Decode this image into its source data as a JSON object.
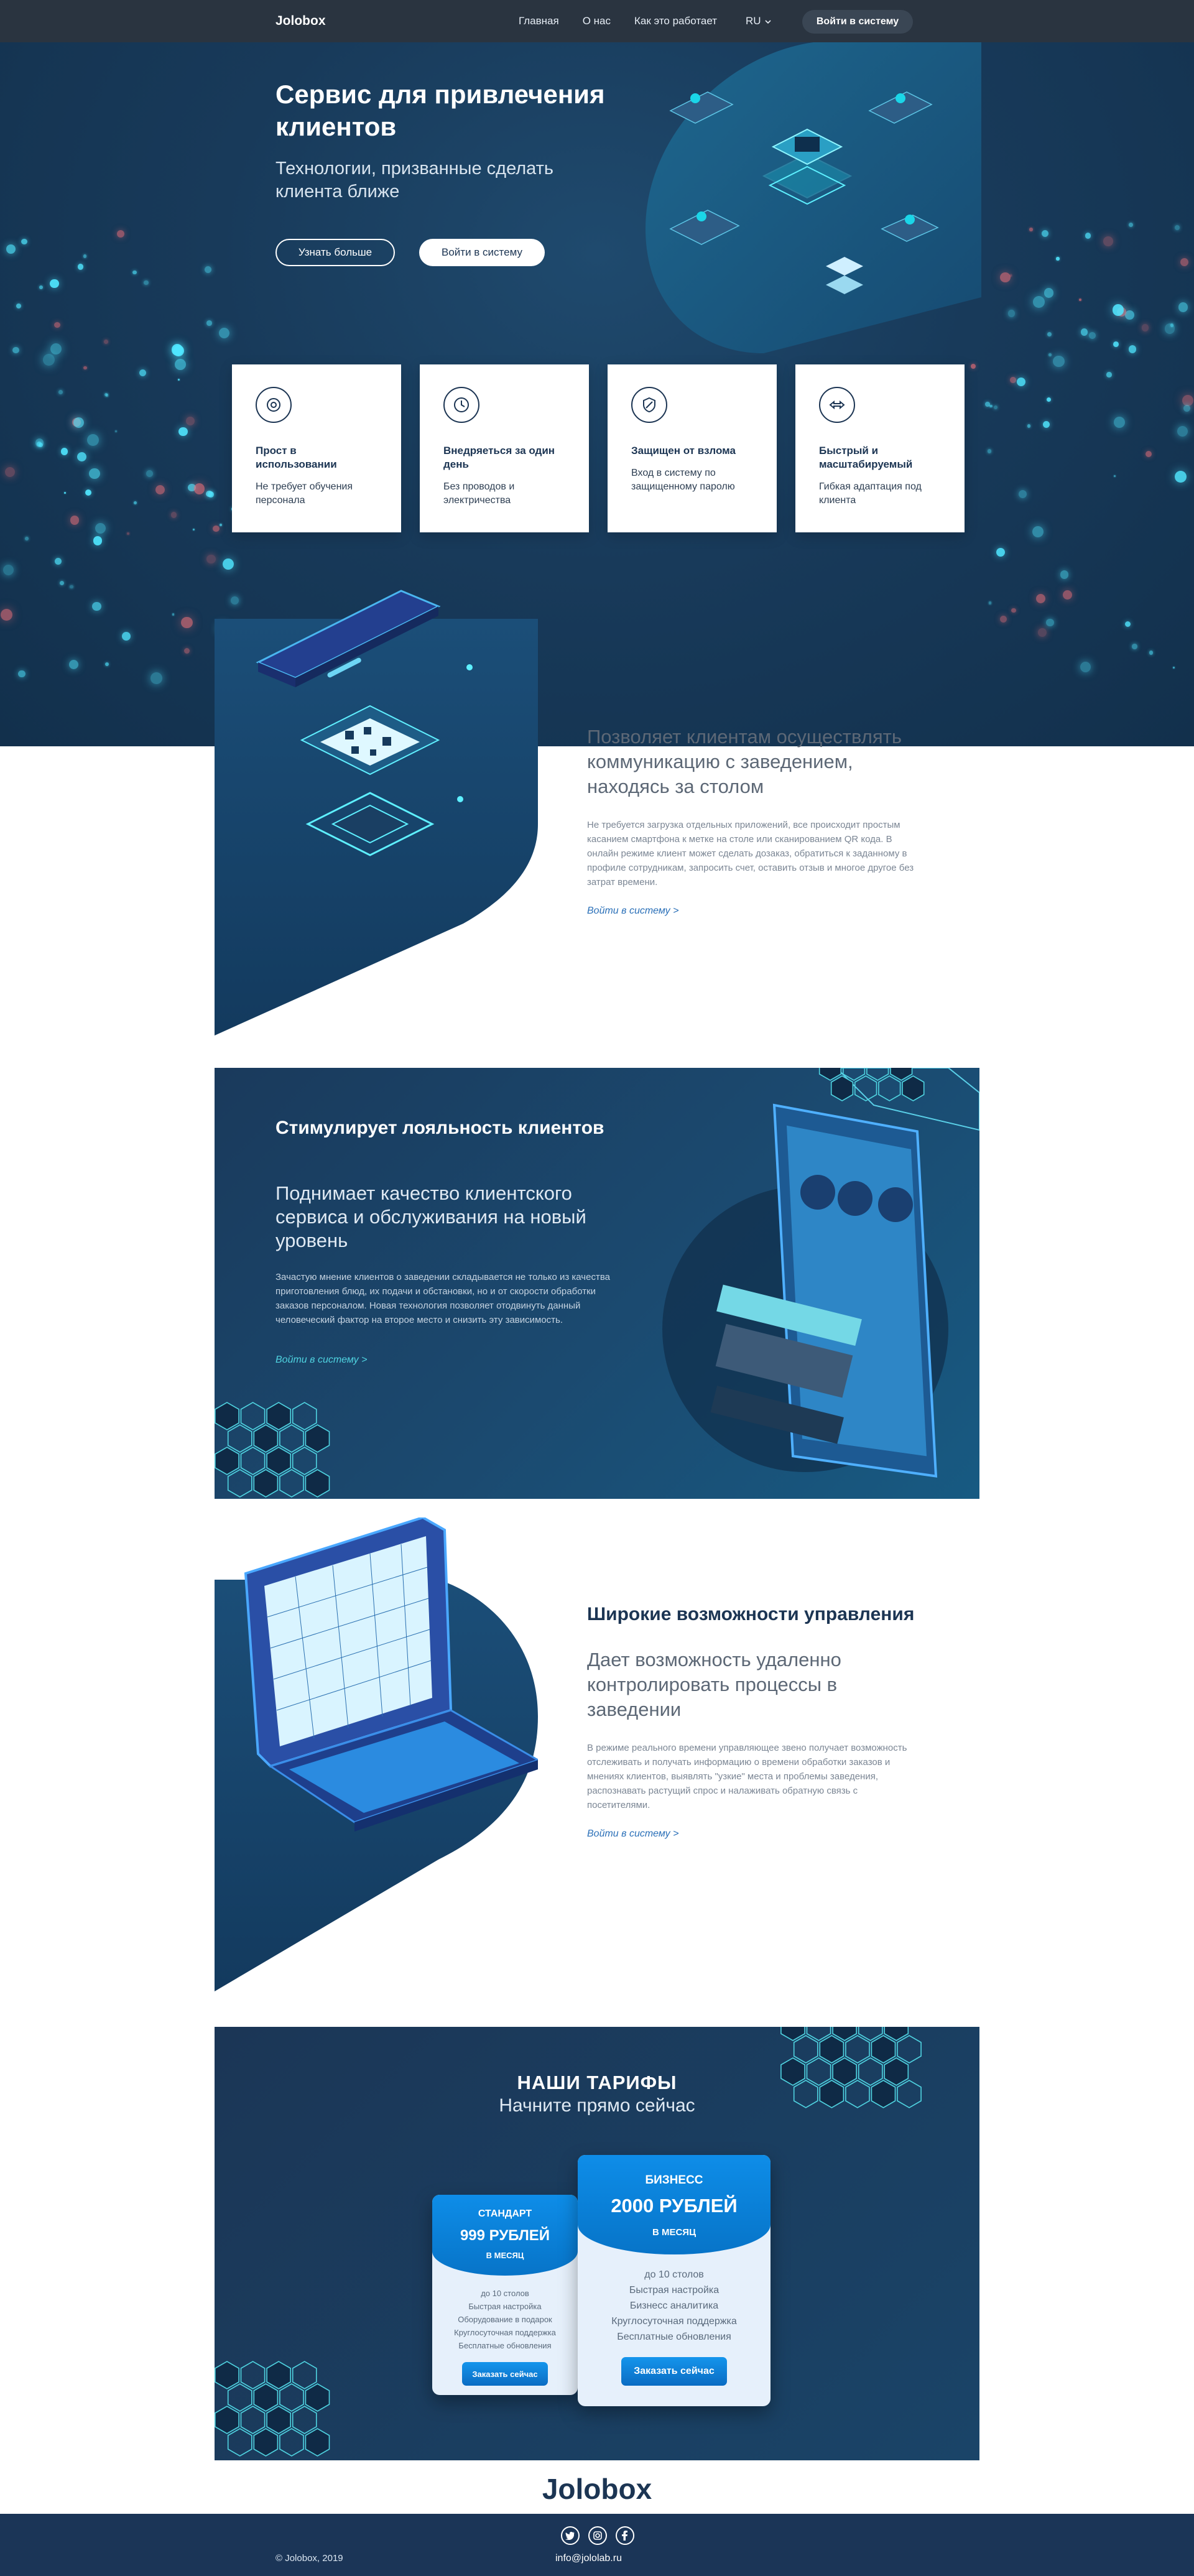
{
  "nav": {
    "logo": "Jolobox",
    "items": [
      "Главная",
      "О нас",
      "Как это работает"
    ],
    "lang": "RU",
    "login": "Войти в систему"
  },
  "hero": {
    "title": "Сервис для привлечения клиентов",
    "subtitle": "Технологии, призванные сделать клиента ближе",
    "btn_more": "Узнать больше",
    "btn_login": "Войти в систему"
  },
  "features": [
    {
      "icon": "settings-icon",
      "title": "Прост в использовании",
      "text": "Не требует обучения персонала"
    },
    {
      "icon": "clock-icon",
      "title": "Внедряеться за один день",
      "text": "Без проводов и электричества"
    },
    {
      "icon": "shield-icon",
      "title": "Защищен от взлома",
      "text": "Вход в систему по защищенному паролю"
    },
    {
      "icon": "arrows-icon",
      "title": "Быстрый и масштабируемый",
      "text": "Гибкая адаптация под клиента"
    }
  ],
  "section_communication": {
    "subtitle": "Позволяет клиентам осуществлять коммуникацию с заведением, находясь за столом",
    "body": "Не требуется загрузка отдельных приложений, все происходит простым касанием смартфона к метке на столе или сканированием QR кода. В онлайн режиме клиент может сделать дозаказ, обратиться к заданному в профиле сотрудникам, запросить счет, оставить отзыв и многое другое без затрат времени.",
    "link": "Войти в систему >"
  },
  "section_loyalty": {
    "title": "Стимулирует лояльность клиентов",
    "subtitle": "Поднимает  качество клиентского сервиса и обслуживания на новый уровень",
    "body": "Зачастую мнение клиентов о заведении складывается не только из качества приготовления блюд, их подачи и обстановки, но и от скорости обработки заказов персоналом. Новая технология позволяет отодвинуть данный человеческий фактор на второе место и снизить эту зависимость.",
    "link": "Войти в систему >"
  },
  "section_management": {
    "title": "Широкие возможности управления",
    "subtitle": "Дает возможность удаленно контролировать процессы в заведении",
    "body": "В режиме реального времени управляющее звено получает возможность отслеживать и получать информацию о времени обработки заказов и мнениях клиентов, выявлять \"узкие\" места и проблемы заведения, распознавать растущий спрос и налаживать обратную связь с посетителями.",
    "link": "Войти в систему >"
  },
  "pricing": {
    "title": "НАШИ ТАРИФЫ",
    "subtitle": "Начните прямо сейчас",
    "standard": {
      "name": "СТАНДАРТ",
      "price": "999 РУБЛЕЙ",
      "period": "В МЕСЯЦ",
      "features": [
        "до 10 столов",
        "Быстрая настройка",
        "Оборудование в подарок",
        "Круглосуточная поддержка",
        "Бесплатные обновления"
      ],
      "button": "Заказать сейчас"
    },
    "business": {
      "name": "БИЗНЕСС",
      "price": "2000 РУБЛЕЙ",
      "period": "В МЕСЯЦ",
      "features": [
        "до 10 столов",
        "Быстрая настройка",
        "Бизнесс аналитика",
        "Круглосуточная поддержка",
        "Бесплатные обновления"
      ],
      "button": "Заказать сейчас"
    }
  },
  "footer": {
    "logo": "Jolobox",
    "copyright": "© Jolobox, 2019",
    "email": "info@jololab.ru",
    "social": [
      "twitter-icon",
      "instagram-icon",
      "facebook-icon"
    ]
  },
  "colors": {
    "nav_bg": "#2a3440",
    "hero_bg": "#183a5a",
    "accent": "#0e8de8",
    "teal": "#4fd3e0",
    "footer_bg": "#1b3557"
  }
}
